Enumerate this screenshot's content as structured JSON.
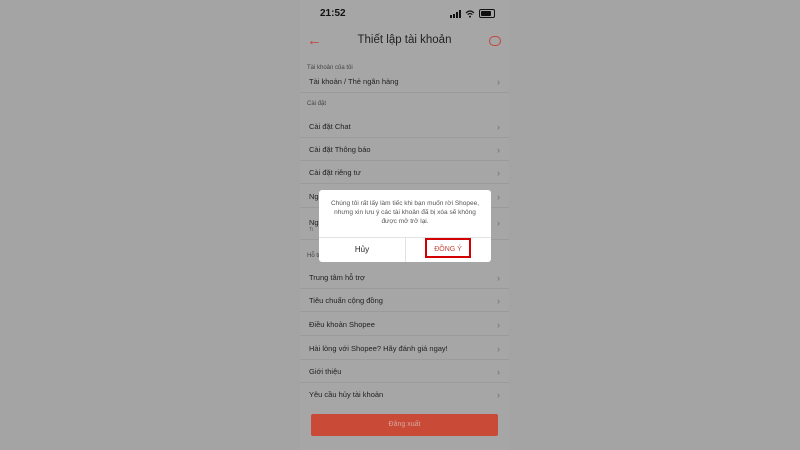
{
  "status_bar": {
    "time": "21:52"
  },
  "header": {
    "title": "Thiết lập tài khoản",
    "back_icon": "arrow-left-icon",
    "chat_icon": "chat-bubble-icon"
  },
  "sections": {
    "my_account": "Tài khoản của tôi",
    "settings": "Cài đặt",
    "support": "Hỗ trợ"
  },
  "rows": {
    "bank": "Tài khoản / Thẻ ngân hàng",
    "chat_settings": "Cài đặt Chat",
    "notification_settings": "Cài đặt Thông báo",
    "privacy_settings": "Cài đặt riêng tư",
    "partial_1": "Ng",
    "partial_2": "Ng",
    "partial_2_sub": "Ti",
    "help_center": "Trung tâm hỗ trợ",
    "community": "Tiêu chuẩn cộng đồng",
    "terms": "Điều khoản Shopee",
    "rate": "Hài lòng với Shopee? Hãy đánh giá ngay!",
    "about": "Giới thiệu",
    "delete_request": "Yêu cầu hủy tài khoản"
  },
  "logout_label": "Đăng xuất",
  "dialog": {
    "message": "Chúng tôi rất lấy làm tiếc khi bạn muốn rời Shopee, nhưng xin lưu ý các tài khoản đã bị xóa sẽ không được mở trở lại.",
    "cancel_label": "Hủy",
    "confirm_label": "ĐỒNG Ý"
  },
  "colors": {
    "accent": "#c4453a",
    "highlight_border": "#d40000"
  }
}
